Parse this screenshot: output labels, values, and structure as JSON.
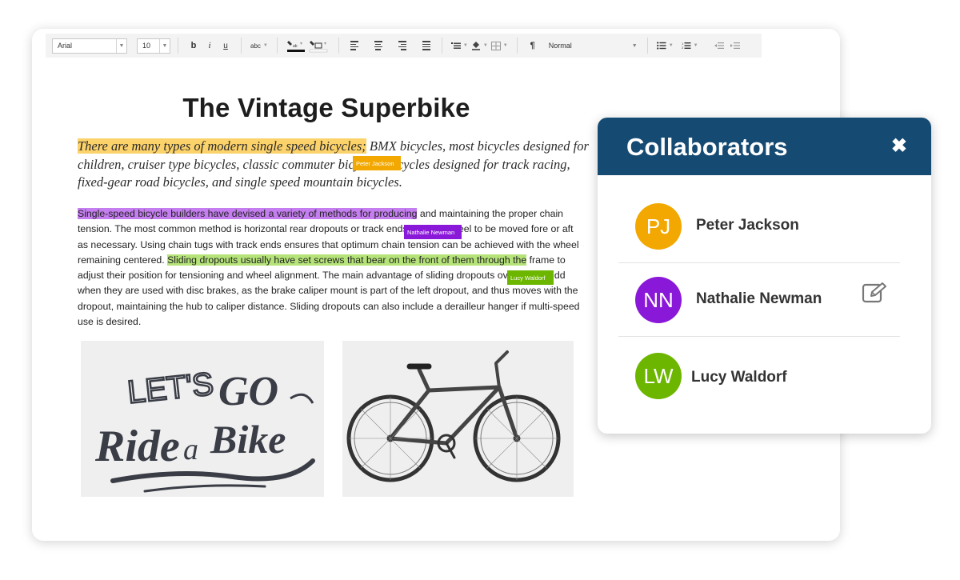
{
  "toolbar": {
    "font_family": "Arial",
    "font_size": "10",
    "bold": "b",
    "italic": "i",
    "underline": "u",
    "spellcheck": "abc",
    "paragraph_mark": "¶",
    "paragraph_style": "Normal"
  },
  "document": {
    "title": "The Vintage Superbike",
    "intro": {
      "highlighted": "There are many types of modern single speed bicycles;",
      "part1": " BMX bicycles, most bicycles designed for children, cruiser type bicycles, classic commuter bic",
      "part2": "ycles, bicycles designed for track racing, fixed-gear road bicycles, and single speed mountain bicycles."
    },
    "body": {
      "hl_purple": "Single-speed bicycle builders have devised a variety of methods for producing",
      "t1": " and maintaining the proper chain tension. The most common method is horizontal rear dropouts or track ends. These allo",
      "t2": "eel to be moved fore or aft as necessary. Using chain tugs with track ends ensures that optimum chain tension can be achieved with the wheel remaining centered. ",
      "hl_green": "Sliding dropouts usually have set screws that bear on the front of them through the",
      "t3": " frame to adjust their position for tensioning and wheel alignment. The main advantage of sliding dropouts over track end",
      "t4": "d when they are used with disc brakes, as the brake caliper mount is part of the left dropout, and thus moves with the dropout, maintaining the hub to caliper distance. Sliding dropouts can also include a derailleur hanger if multi-speed use is desired."
    },
    "tags": {
      "peter": "Peter Jackson",
      "nathalie": "Nathalie Newman",
      "lucy": "Lucy Waldorf"
    },
    "image_left_text": {
      "line1a": "LET'S",
      "line1b": "GO",
      "line2a": "Ride",
      "line2b": "a",
      "line2c": "Bike"
    }
  },
  "collaborators": {
    "title": "Collaborators",
    "close": "✖",
    "people": [
      {
        "initials": "PJ",
        "name": "Peter Jackson",
        "color": "#f2a800"
      },
      {
        "initials": "NN",
        "name": "Nathalie Newman",
        "color": "#8a18d8"
      },
      {
        "initials": "LW",
        "name": "Lucy Waldorf",
        "color": "#6cb600"
      }
    ]
  },
  "colors": {
    "header": "#154a72",
    "highlight_yellow": "#fcd26a",
    "highlight_purple": "#c57ef0",
    "highlight_green": "#b5e37a"
  }
}
